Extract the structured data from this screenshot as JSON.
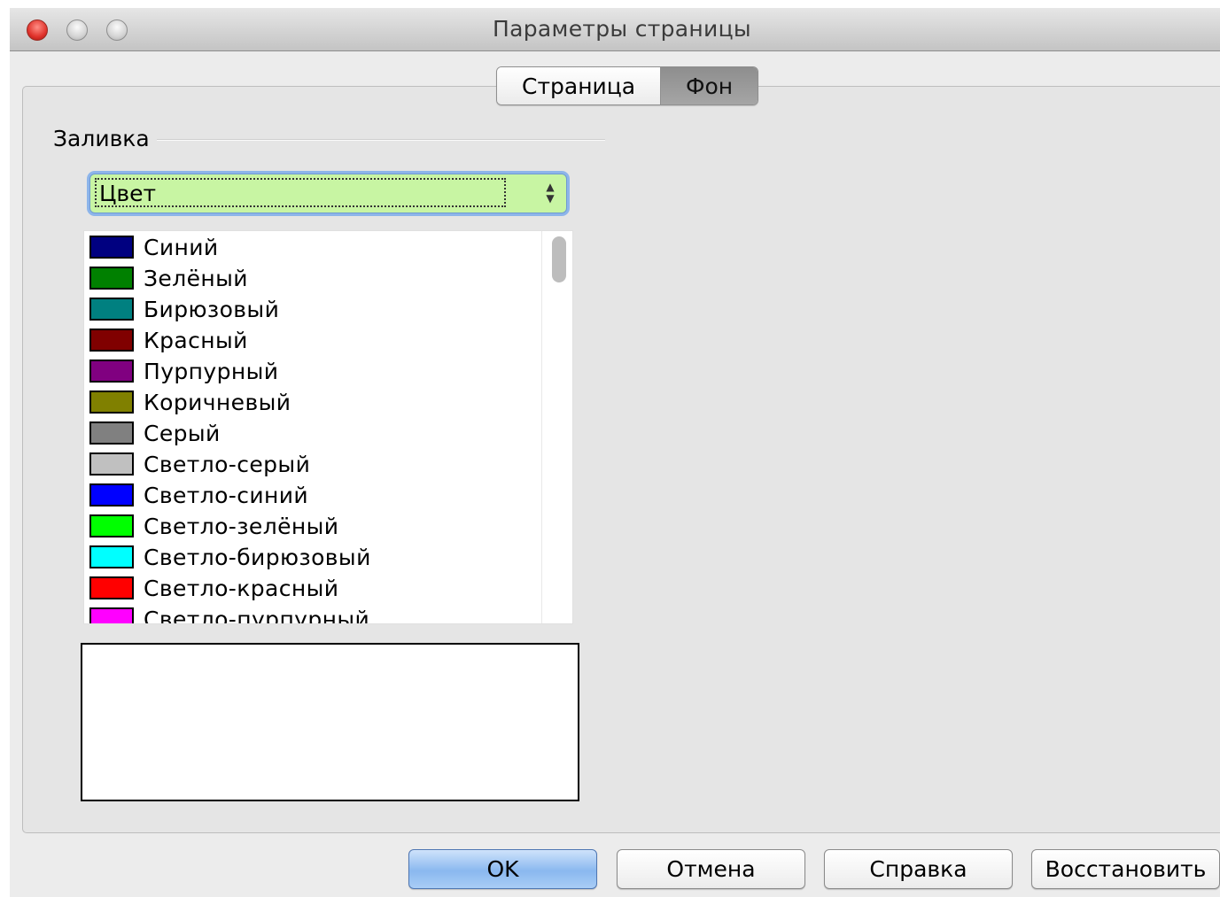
{
  "window": {
    "title": "Параметры страницы"
  },
  "tabs": [
    {
      "label": "Страница",
      "selected": false
    },
    {
      "label": "Фон",
      "selected": true
    }
  ],
  "fill": {
    "section_label": "Заливка",
    "type_select": {
      "value": "Цвет"
    },
    "colors": [
      {
        "label": "Синий",
        "color": "#000080"
      },
      {
        "label": "Зелёный",
        "color": "#008000"
      },
      {
        "label": "Бирюзовый",
        "color": "#008080"
      },
      {
        "label": "Красный",
        "color": "#800000"
      },
      {
        "label": "Пурпурный",
        "color": "#800080"
      },
      {
        "label": "Коричневый",
        "color": "#808000"
      },
      {
        "label": "Серый",
        "color": "#808080"
      },
      {
        "label": "Светло-серый",
        "color": "#c0c0c0"
      },
      {
        "label": "Светло-синий",
        "color": "#0000ff"
      },
      {
        "label": "Светло-зелёный",
        "color": "#00ff00"
      },
      {
        "label": "Светло-бирюзовый",
        "color": "#00ffff"
      },
      {
        "label": "Светло-красный",
        "color": "#ff0000"
      },
      {
        "label": "Светло-пурпурный",
        "color": "#ff00ff"
      }
    ]
  },
  "buttons": {
    "ok": "OK",
    "cancel": "Отмена",
    "help": "Справка",
    "reset": "Восстановить"
  }
}
